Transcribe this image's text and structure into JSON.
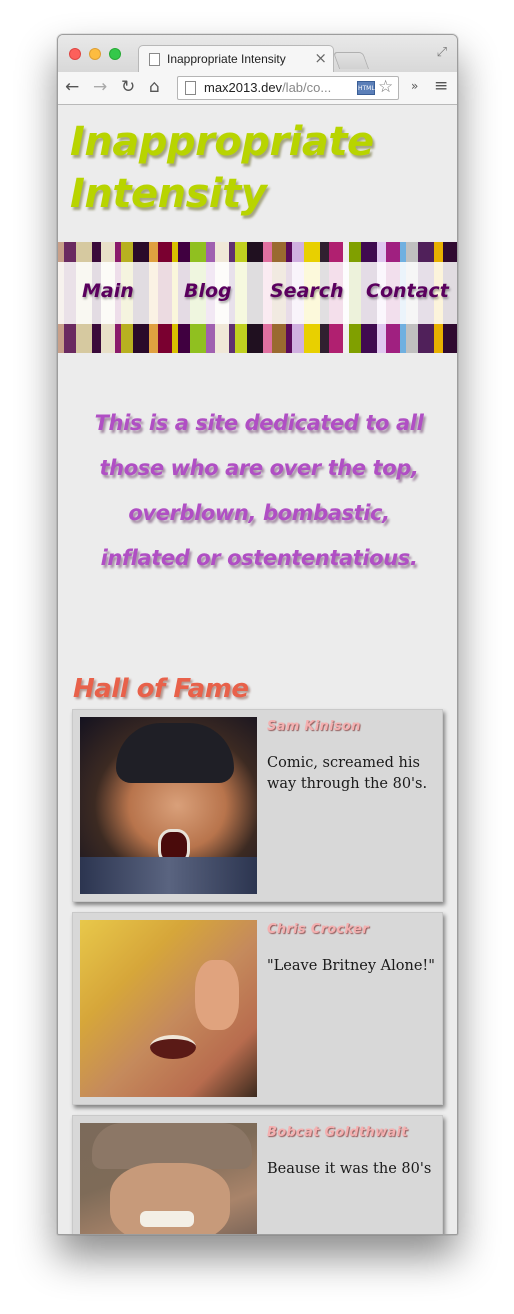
{
  "browser": {
    "tab_title": "Inappropriate Intensity",
    "tab_close": "×",
    "url_host": "max2013.dev",
    "url_path": "/lab/co...",
    "overflow_label": "»"
  },
  "site": {
    "title": "Inappropriate Intensity",
    "nav": [
      "Main",
      "Blog",
      "Search",
      "Contact"
    ],
    "tagline": "This is a site dedicated to all those who are over the top, overblown, bombastic, inflated or ostententatious.",
    "hall_of_fame": {
      "heading": "Hall of Fame",
      "entries": [
        {
          "name": "Sam Kinison",
          "desc": "Comic, screamed his way through the 80's."
        },
        {
          "name": "Chris Crocker",
          "desc": "\"Leave Britney Alone!\""
        },
        {
          "name": "Bobcat Goldthwait",
          "desc": "Beause it was the 80's"
        }
      ]
    }
  },
  "colors": {
    "title": "#b8d400",
    "nav": "#5a005e",
    "tagline": "#b04fc4",
    "heading": "#e8614a",
    "card_name": "#f4b0b0"
  },
  "icons": [
    "back-icon",
    "forward-icon",
    "reload-icon",
    "home-icon",
    "page-icon",
    "html5-icon",
    "star-icon",
    "menu-icon"
  ]
}
